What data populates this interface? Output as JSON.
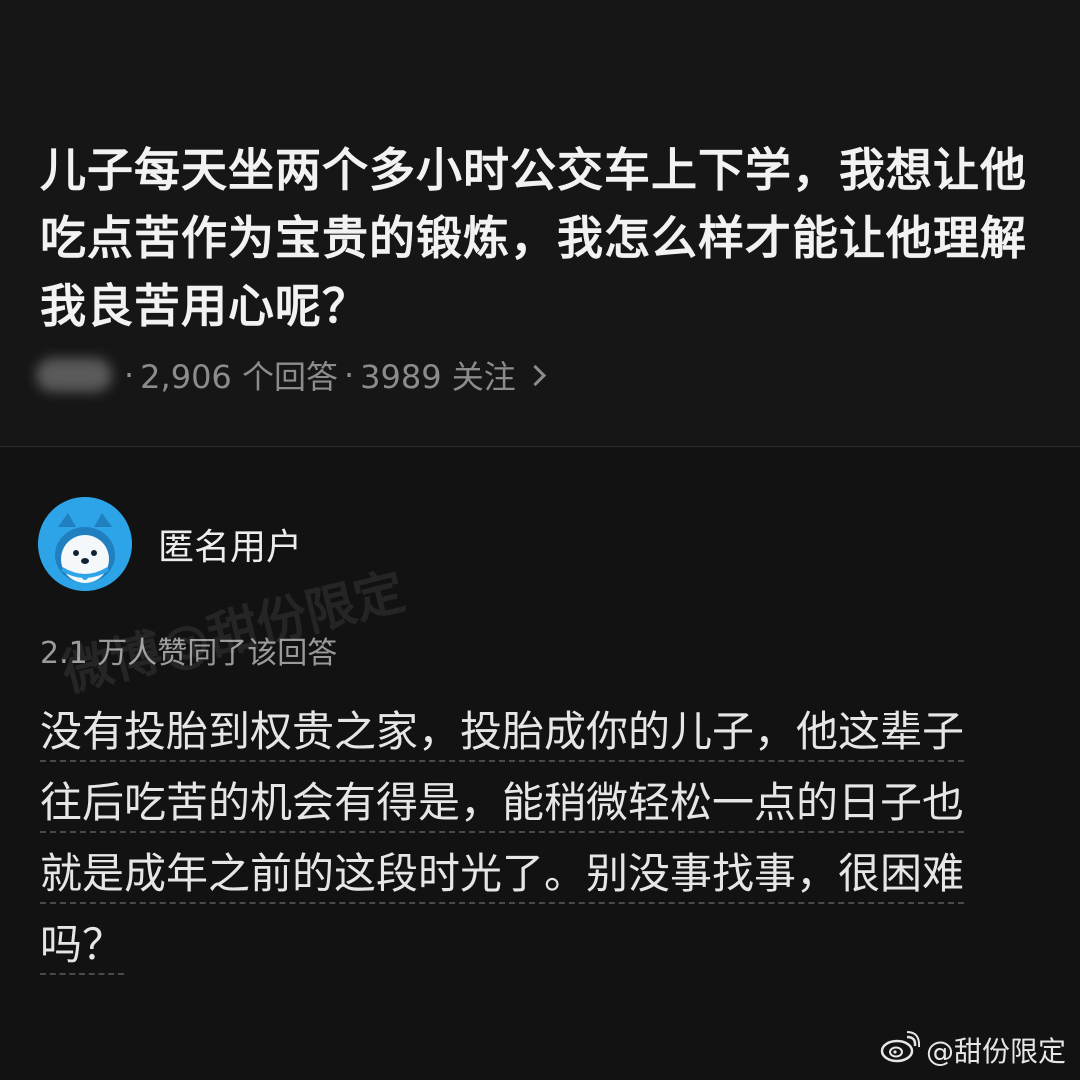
{
  "question": {
    "title": "儿子每天坐两个多小时公交车上下学，我想让他吃点苦作为宝贵的锻炼，我怎么样才能让他理解我良苦用心呢？",
    "separator": "·",
    "answers_count": "2,906 个回答",
    "followers_count": "3989 关注"
  },
  "answer": {
    "author_name": "匿名用户",
    "approve_text": "2.1 万人赞同了该回答",
    "body_lines": [
      "没有投胎到权贵之家，投胎成你的儿子，他这辈子",
      "往后吃苦的机会有得是，能稍微轻松一点的日子也",
      "就是成年之前的这段时光了。别没事找事，很困难",
      "吗？"
    ]
  },
  "watermarks": {
    "diagonal": "微博@甜份限定",
    "corner": "@甜份限定"
  },
  "colors": {
    "background": "#121212",
    "avatar_blue": "#2da4e8",
    "muted_text": "#8c8c8c"
  },
  "icons": {
    "chevron": "chevron-right-icon",
    "avatar": "anonymous-avatar-icon",
    "weibo": "weibo-logo-icon"
  }
}
